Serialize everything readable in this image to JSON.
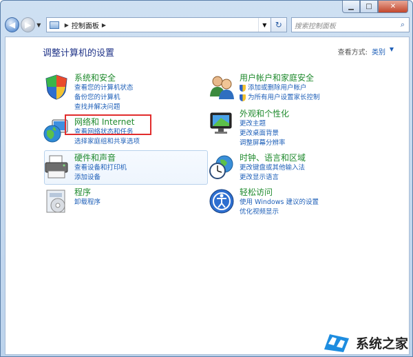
{
  "window": {
    "min_icon": "minimize-icon",
    "max_icon": "maximize-icon",
    "close_icon": "close-icon"
  },
  "toolbar": {
    "address": "控制面板",
    "search_placeholder": "搜索控制面板"
  },
  "main": {
    "title": "调整计算机的设置",
    "view_by_label": "查看方式:",
    "view_by_value": "类别"
  },
  "categories": {
    "security": {
      "icon": "shield-icon",
      "title": "系统和安全",
      "links": [
        "查看您的计算机状态",
        "备份您的计算机",
        "查找并解决问题"
      ]
    },
    "network": {
      "icon": "network-globe-icon",
      "title": "网络和 Internet",
      "links": [
        "查看网络状态和任务",
        "选择家庭组和共享选项"
      ]
    },
    "hardware": {
      "icon": "printer-icon",
      "title": "硬件和声音",
      "links": [
        "查看设备和打印机",
        "添加设备"
      ]
    },
    "programs": {
      "icon": "programs-disc-icon",
      "title": "程序",
      "links": [
        "卸载程序"
      ]
    },
    "users": {
      "icon": "users-icon",
      "title": "用户帐户和家庭安全",
      "links": [
        "添加或删除用户帐户",
        "为所有用户设置家长控制"
      ]
    },
    "appearance": {
      "icon": "monitor-icon",
      "title": "外观和个性化",
      "links": [
        "更改主题",
        "更改桌面背景",
        "调整屏幕分辨率"
      ]
    },
    "clock": {
      "icon": "clock-globe-icon",
      "title": "时钟、语言和区域",
      "links": [
        "更改键盘或其他输入法",
        "更改显示语言"
      ]
    },
    "access": {
      "icon": "ease-of-access-icon",
      "title": "轻松访问",
      "links": [
        "使用 Windows 建议的设置",
        "优化视频显示"
      ]
    }
  },
  "watermark": {
    "text": "系统之家"
  }
}
